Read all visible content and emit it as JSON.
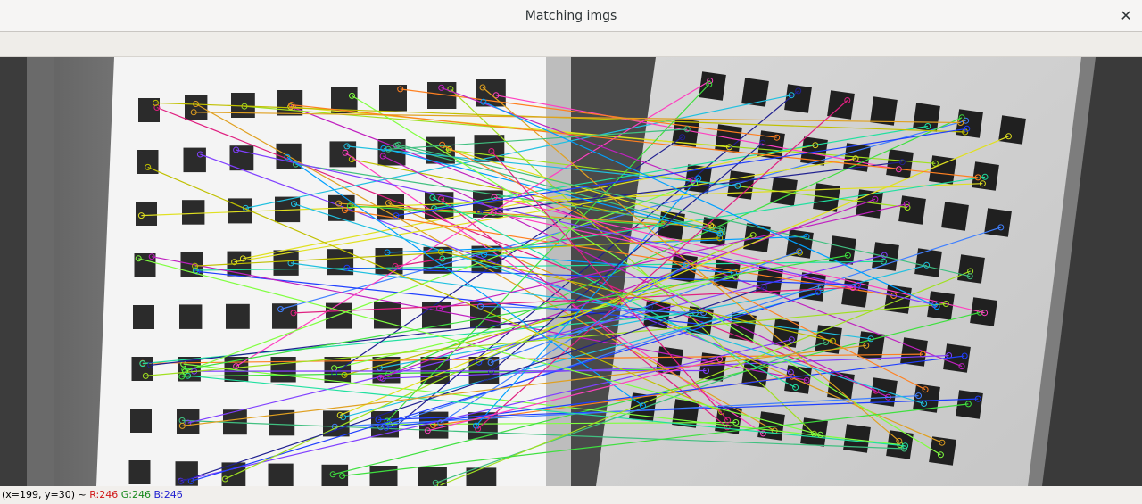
{
  "window": {
    "title": "Matching imgs",
    "close_glyph": "✕",
    "close_icon": "close-icon"
  },
  "status": {
    "coords": "(x=199, y=30) ~",
    "r": "R:246",
    "g": "G:246",
    "b": "B:246"
  },
  "colors": {
    "r_label": "#d01616",
    "g_label": "#17891d",
    "b_label": "#1f1fd0"
  }
}
